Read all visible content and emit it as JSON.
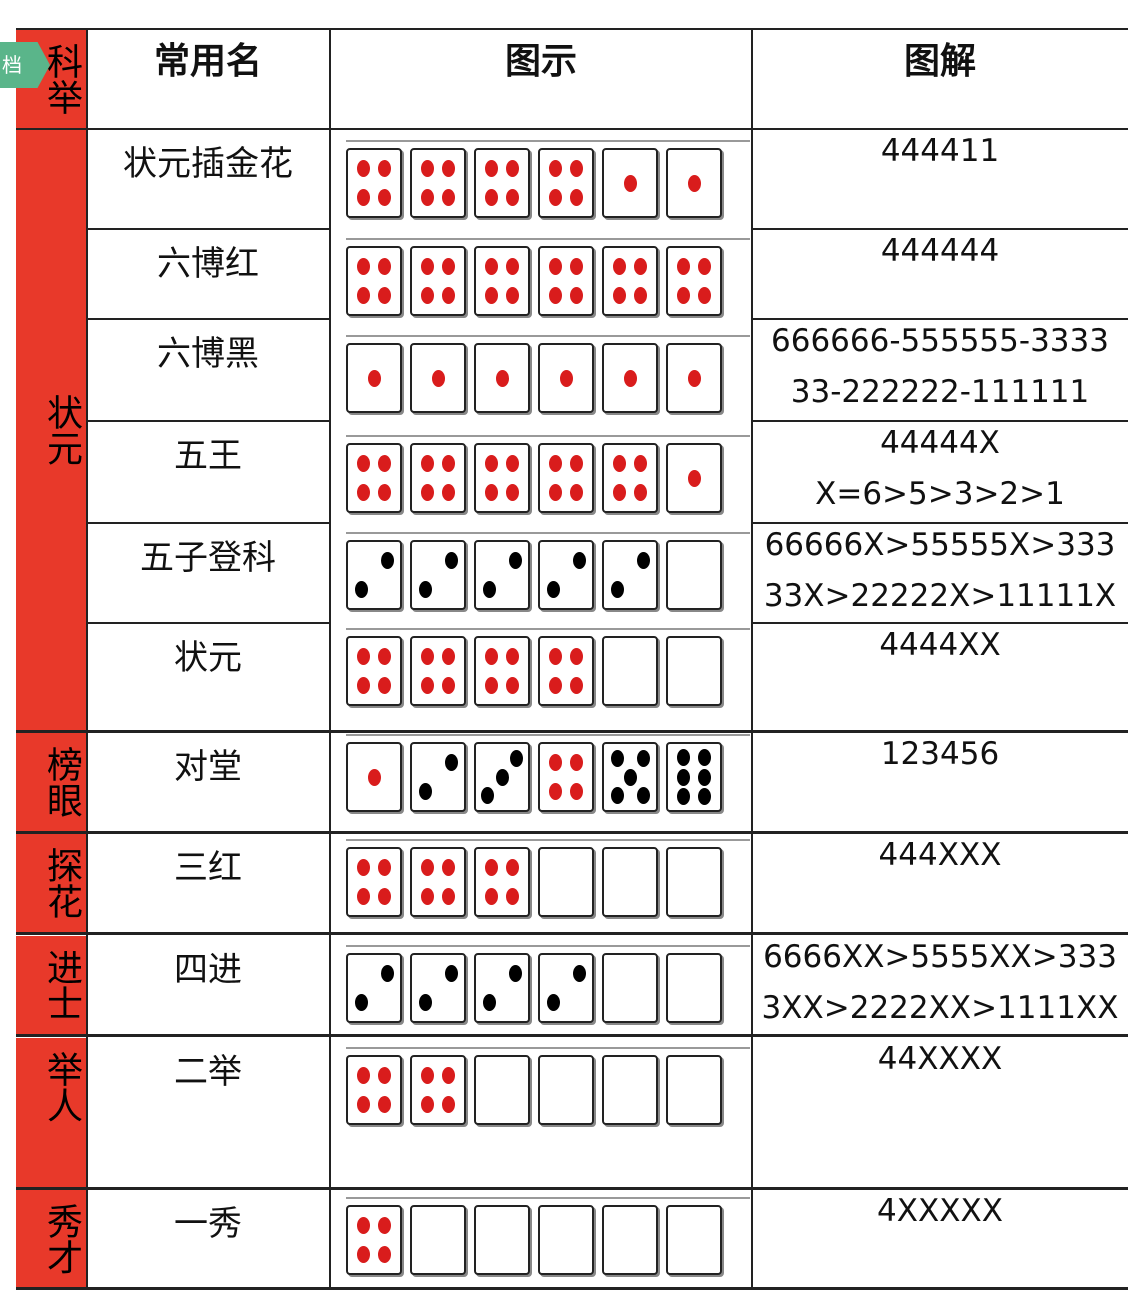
{
  "badge": "档",
  "headers": {
    "category": "科举",
    "name": "常用名",
    "diagram": "图示",
    "explanation": "图解"
  },
  "categories": [
    {
      "label": "状元"
    },
    {
      "label": "榜眼"
    },
    {
      "label": "探花"
    },
    {
      "label": "进士"
    },
    {
      "label": "举人"
    },
    {
      "label": "秀才"
    }
  ],
  "rows": [
    {
      "name": "状元插金花",
      "code": [
        "444411"
      ],
      "dice": [
        4,
        4,
        4,
        4,
        1,
        1
      ]
    },
    {
      "name": "六博红",
      "code": [
        "444444"
      ],
      "dice": [
        4,
        4,
        4,
        4,
        4,
        4
      ]
    },
    {
      "name": "六博黑",
      "code": [
        "666666-555555-3333",
        "33-222222-111111"
      ],
      "dice": [
        1,
        1,
        1,
        1,
        1,
        1
      ]
    },
    {
      "name": "五王",
      "code": [
        "44444X",
        "X=6>5>3>2>1"
      ],
      "dice": [
        4,
        4,
        4,
        4,
        4,
        1
      ]
    },
    {
      "name": "五子登科",
      "code": [
        "66666X>55555X>333",
        "33X>22222X>11111X"
      ],
      "dice": [
        2,
        2,
        2,
        2,
        2,
        0
      ]
    },
    {
      "name": "状元",
      "code": [
        "4444XX"
      ],
      "dice": [
        4,
        4,
        4,
        4,
        0,
        0
      ]
    },
    {
      "name": "对堂",
      "code": [
        "123456"
      ],
      "dice": [
        1,
        2,
        3,
        4,
        5,
        6
      ]
    },
    {
      "name": "三红",
      "code": [
        "444XXX"
      ],
      "dice": [
        4,
        4,
        4,
        0,
        0,
        0
      ]
    },
    {
      "name": "四进",
      "code": [
        "6666XX>5555XX>333",
        "3XX>2222XX>1111XX"
      ],
      "dice": [
        2,
        2,
        2,
        2,
        0,
        0
      ]
    },
    {
      "name": "二举",
      "code": [
        "44XXXX"
      ],
      "dice": [
        4,
        4,
        0,
        0,
        0,
        0
      ]
    },
    {
      "name": "一秀",
      "code": [
        "4XXXXX"
      ],
      "dice": [
        4,
        0,
        0,
        0,
        0,
        0
      ]
    }
  ]
}
